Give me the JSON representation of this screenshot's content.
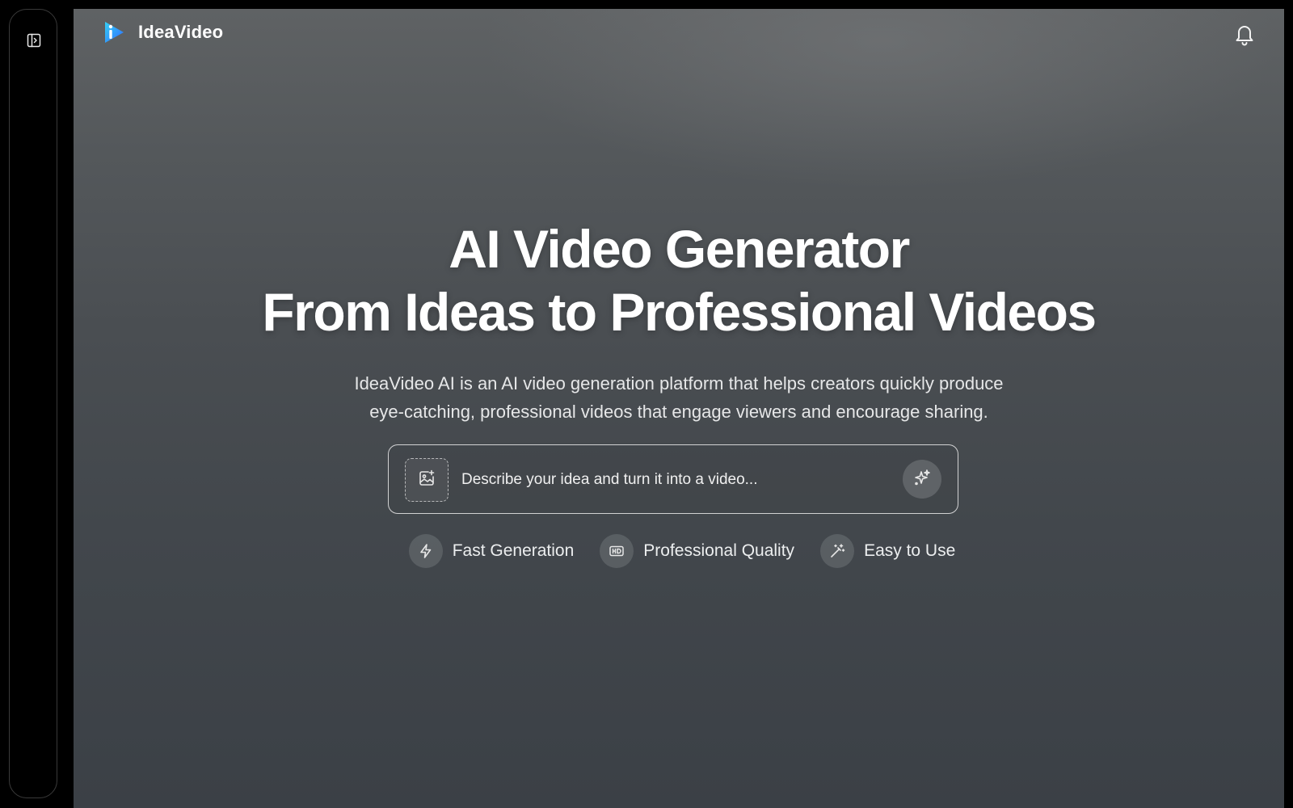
{
  "brand": {
    "name": "IdeaVideo",
    "logo_icon": "play-triangle-logo-icon"
  },
  "header": {
    "notification_icon": "bell-icon"
  },
  "sidebar": {
    "toggle_icon": "sidebar-toggle-icon"
  },
  "hero": {
    "title_line1": "AI Video Generator",
    "title_line2": "From Ideas to Professional Videos",
    "subtitle_line1": "IdeaVideo AI is an AI video generation platform that helps creators quickly produce",
    "subtitle_line2": "eye-catching, professional videos that engage viewers and encourage sharing."
  },
  "prompt": {
    "placeholder": "Describe your idea and turn it into a video...",
    "value": "",
    "upload_icon": "image-plus-icon",
    "generate_icon": "sparkles-icon"
  },
  "features": [
    {
      "label": "Fast Generation",
      "icon": "lightning-icon"
    },
    {
      "label": "Professional Quality",
      "icon": "hd-icon"
    },
    {
      "label": "Easy to Use",
      "icon": "magic-wand-icon"
    }
  ],
  "colors": {
    "logo_blue": "#2f8cff",
    "logo_cyan": "#35d0f5",
    "text_primary": "#ffffff"
  }
}
